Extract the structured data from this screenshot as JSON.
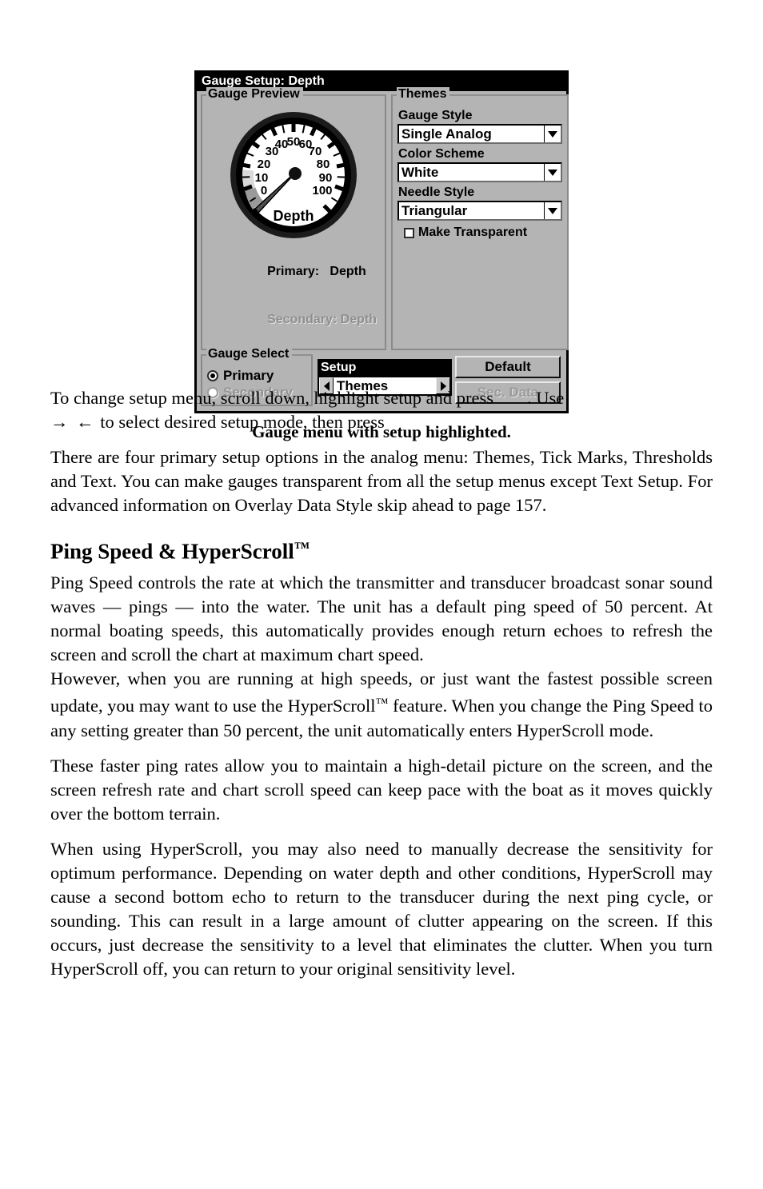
{
  "dialog": {
    "title": "Gauge Setup: Depth",
    "preview_group": {
      "legend": "Gauge Preview",
      "gauge": {
        "label": "Depth",
        "tick_labels": [
          "0",
          "10",
          "20",
          "30",
          "40",
          "50",
          "60",
          "70",
          "80",
          "90",
          "100"
        ],
        "min": 0,
        "max": 100,
        "value": 0,
        "needle_style": "Triangular",
        "face_color": "#ffffff",
        "bezel_color": "#000000"
      },
      "primary_label": "Primary:",
      "primary_value": "Depth",
      "secondary_label": "Secondary:",
      "secondary_value": "Depth",
      "secondary_disabled": true
    },
    "themes_group": {
      "legend": "Themes",
      "gauge_style_label": "Gauge Style",
      "gauge_style_value": "Single Analog",
      "color_scheme_label": "Color Scheme",
      "color_scheme_value": "White",
      "needle_style_label": "Needle Style",
      "needle_style_value": "Triangular",
      "make_transparent_label": "Make Transparent",
      "make_transparent_checked": false
    },
    "gauge_select_group": {
      "legend": "Gauge Select",
      "primary_label": "Primary",
      "primary_selected": true,
      "secondary_label": "Secondary",
      "secondary_selected": false,
      "secondary_disabled": true
    },
    "setup": {
      "header": "Setup",
      "value": "Themes",
      "left_arrow": "◀",
      "right_arrow": "▶"
    },
    "buttons": {
      "default_label": "Default",
      "sec_data_label": "Sec. Data",
      "sec_data_disabled": true
    },
    "colors": {
      "dialog_face": "#b4b4b4",
      "titlebar": "#000000",
      "titlebar_text": "#ffffff",
      "disabled_text": "#949494"
    }
  },
  "figure_caption": "Gauge menu with setup highlighted.",
  "body": {
    "p_instruction_part1": "To change setup menu, scroll down, highlight setup and press",
    "p_instruction_part2": ". Use",
    "p_instruction_arrows": "→ ←",
    "p_instruction_part3": "to select desired setup mode, then press",
    "p_setup_options": "There are four primary setup options in the analog menu: Themes, Tick Marks, Thresholds and Text. You can make gauges transparent from all the setup menus except Text Setup. For advanced information on Overlay Data Style skip ahead to page 157.",
    "heading_ping_speed": "Ping Speed & HyperScroll",
    "heading_ping_speed_tm": "™",
    "p_ping_speed": "Ping Speed controls the rate at which the transmitter and transducer broadcast sonar sound waves — pings — into the water. The unit has a default ping speed of 50 percent. At normal boating speeds, this automatically provides enough return echoes to refresh the screen and scroll the chart at maximum chart speed.",
    "p_however_a": "However, when you are running at high speeds, or just want the fastest possible screen update, you may want to use the HyperScroll",
    "p_however_tm": "™",
    "p_however_b": " feature. When you change the Ping Speed to any setting greater than 50 percent, the unit automatically enters HyperScroll mode.",
    "p_faster_rates": "These faster ping rates allow you to maintain a high-detail picture on the screen, and the screen refresh rate and chart scroll speed can keep pace with the boat as it moves quickly over the bottom terrain.",
    "p_sensitivity": "When using HyperScroll, you may also need to manually decrease the sensitivity for optimum performance. Depending on water depth and other conditions, HyperScroll may cause a second bottom echo to return to the transducer during the next ping cycle, or sounding. This can result in a large amount of clutter appearing on the screen. If this occurs, just decrease the sensitivity to a level that eliminates the clutter. When you turn HyperScroll off, you can return to your original sensitivity level."
  }
}
